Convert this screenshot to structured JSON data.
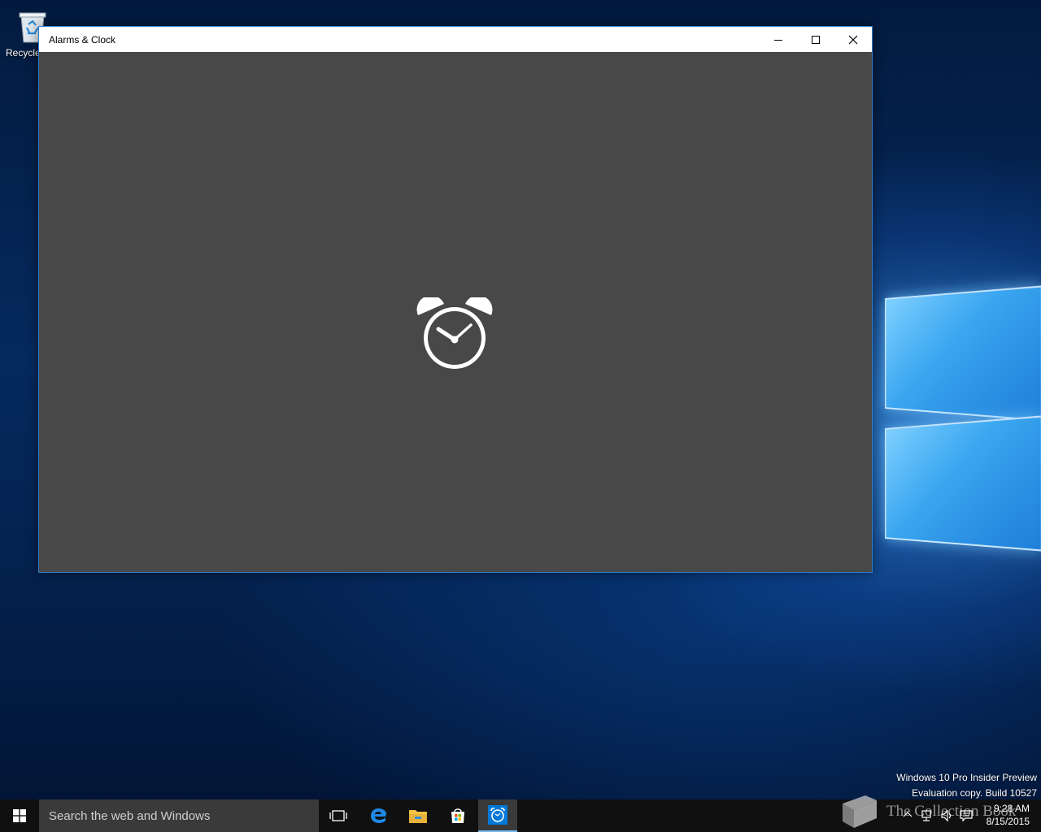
{
  "desktop": {
    "icons": [
      {
        "label": "Recycle",
        "icon": "recycle-bin-icon"
      }
    ],
    "watermark": {
      "line1": "Windows 10 Pro Insider Preview",
      "line2": "Evaluation copy. Build 10527"
    }
  },
  "window": {
    "title": "Alarms & Clock",
    "controls": [
      "minimize",
      "maximize",
      "close"
    ],
    "splash_icon": "alarm-clock-icon",
    "background_color": "#484848"
  },
  "taskbar": {
    "search_placeholder": "Search the web and Windows",
    "pinned": [
      "task-view",
      "edge",
      "file-explorer",
      "store",
      "alarms-clock"
    ],
    "active_app": "alarms-clock",
    "overlay_text": "The Collection Book",
    "clock": {
      "time": "9:28 AM",
      "date": "8/15/2015"
    }
  },
  "colors": {
    "accent": "#0078d7",
    "taskbar": "#101010",
    "active_underline": "#76b9ed"
  }
}
